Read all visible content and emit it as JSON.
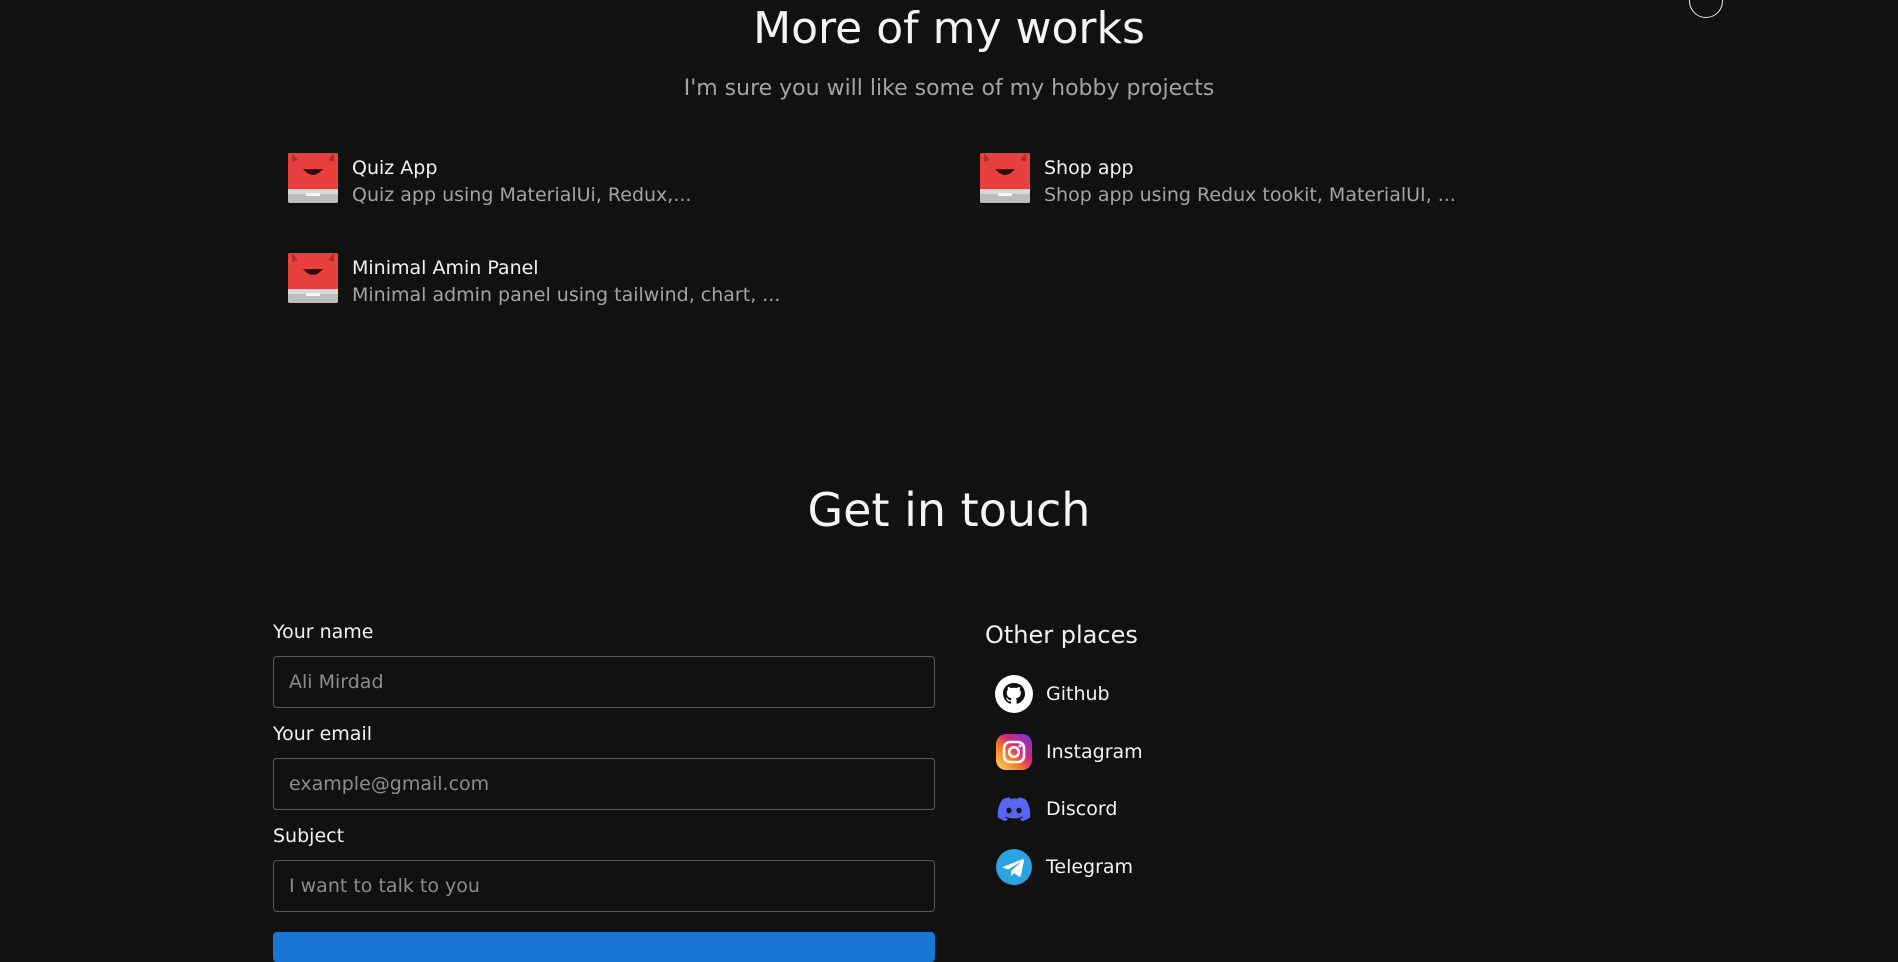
{
  "works": {
    "title": "More of my works",
    "subtitle": "I'm sure you will like some of my hobby projects",
    "projects": [
      {
        "title": "Quiz App",
        "description": "Quiz app using MaterialUi, Redux,..."
      },
      {
        "title": "Shop app",
        "description": "Shop app using Redux tookit, MaterialUI, ..."
      },
      {
        "title": "Minimal Amin Panel",
        "description": "Minimal admin panel using tailwind, chart, ..."
      }
    ]
  },
  "contact": {
    "title": "Get in touch",
    "fields": [
      {
        "label": "Your name",
        "placeholder": "Ali Mirdad"
      },
      {
        "label": "Your email",
        "placeholder": "example@gmail.com"
      },
      {
        "label": "Subject",
        "placeholder": "I want to talk to you"
      }
    ],
    "submit_color": "#1976d2"
  },
  "other_places": {
    "title": "Other places",
    "links": [
      {
        "label": "Github",
        "icon": "github-icon"
      },
      {
        "label": "Instagram",
        "icon": "instagram-icon"
      },
      {
        "label": "Discord",
        "icon": "discord-icon"
      },
      {
        "label": "Telegram",
        "icon": "telegram-icon"
      }
    ]
  },
  "colors": {
    "background": "#111111",
    "muted_text": "#a3a3a3",
    "thumbnail_red": "#e8403f",
    "discord": "#5865f2",
    "telegram": "#2aa3e0"
  }
}
